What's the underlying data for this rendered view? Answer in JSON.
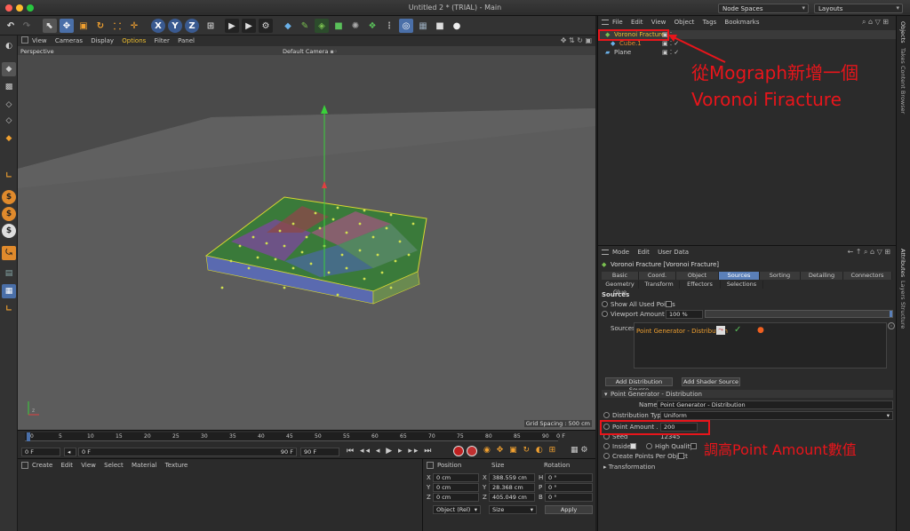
{
  "window": {
    "title": "Untitled 2 * (TRIAL) - Main",
    "node_spaces": "Node Spaces",
    "layouts": "Layouts"
  },
  "toolbar": {
    "x_label": "X",
    "y_label": "Y",
    "z_label": "Z"
  },
  "viewport": {
    "menu": [
      "View",
      "Cameras",
      "Display",
      "Options",
      "Filter",
      "Panel"
    ],
    "projection": "Perspective",
    "camera": "Default Camera",
    "grid_spacing": "Grid Spacing : 500 cm"
  },
  "timeline": {
    "ticks": [
      "0",
      "5",
      "10",
      "15",
      "20",
      "25",
      "30",
      "35",
      "40",
      "45",
      "50",
      "55",
      "60",
      "65",
      "70",
      "75",
      "80",
      "85",
      "90"
    ],
    "frame_end_label": "0 F",
    "current": "0 F",
    "start": "0 F",
    "end": "90 F",
    "max": "90 F"
  },
  "materials": {
    "menu": [
      "Create",
      "Edit",
      "View",
      "Select",
      "Material",
      "Texture"
    ]
  },
  "coords": {
    "headers": [
      "Position",
      "Size",
      "Rotation"
    ],
    "rows": [
      {
        "axis": "X",
        "pos": "0 cm",
        "size_axis": "X",
        "size": "388.559 cm",
        "rot_axis": "H",
        "rot": "0 °"
      },
      {
        "axis": "Y",
        "pos": "0 cm",
        "size_axis": "Y",
        "size": "28.368 cm",
        "rot_axis": "P",
        "rot": "0 °"
      },
      {
        "axis": "Z",
        "pos": "0 cm",
        "size_axis": "Z",
        "size": "405.049 cm",
        "rot_axis": "B",
        "rot": "0 °"
      }
    ],
    "mode": "Object (Rel)",
    "size_mode": "Size",
    "apply": "Apply"
  },
  "object_manager": {
    "menu": [
      "File",
      "Edit",
      "View",
      "Object",
      "Tags",
      "Bookmarks"
    ],
    "objects": [
      "Voronoi Fracture",
      "Cube.1",
      "Plane"
    ]
  },
  "attribute_manager": {
    "menu": [
      "Mode",
      "Edit",
      "User Data"
    ],
    "object_title": "Voronoi Fracture [Voronoi Fracture]",
    "tabs_row1": [
      "Basic",
      "Coord.",
      "Object",
      "Sources",
      "Sorting",
      "Detailing",
      "Connectors"
    ],
    "tabs_row2": [
      "Geometry Glue",
      "Transform",
      "Effectors",
      "Selections"
    ],
    "active_tab": "Sources",
    "section": "Sources",
    "show_all_used_points": "Show All Used Points",
    "viewport_amount_label": "Viewport Amount . .",
    "viewport_amount": "100 %",
    "sources_label": "Sources",
    "source_item": "Point Generator - Distribution",
    "add_distribution": "Add Distribution Source",
    "add_shader": "Add Shader Source",
    "subsection": "Point Generator - Distribution",
    "name_label": "Name",
    "name_value": "Point Generator - Distribution",
    "dist_type_label": "Distribution Type",
    "dist_type_value": "Uniform",
    "point_amount_label": "Point Amount . . .",
    "point_amount": "200",
    "seed_label": "Seed",
    "seed": "12345",
    "inside_label": "Inside",
    "high_quality_label": "High Quality",
    "create_points_label": "Create Points Per Object",
    "transformation": "Transformation"
  },
  "side_tabs": [
    "Objects",
    "Takes",
    "Content Browser",
    "Attributes",
    "Layers",
    "Structure"
  ],
  "annotations": {
    "mograph_line1": "從Mograph新增一個",
    "mograph_line2": "Voronoi Firacture",
    "point_amount": "調高Point Amount數值"
  },
  "colors": {
    "accent": "#5a7fb8",
    "annotation": "#e8151b",
    "voronoi_name": "#f0c030",
    "cube_name": "#e08a2c"
  }
}
